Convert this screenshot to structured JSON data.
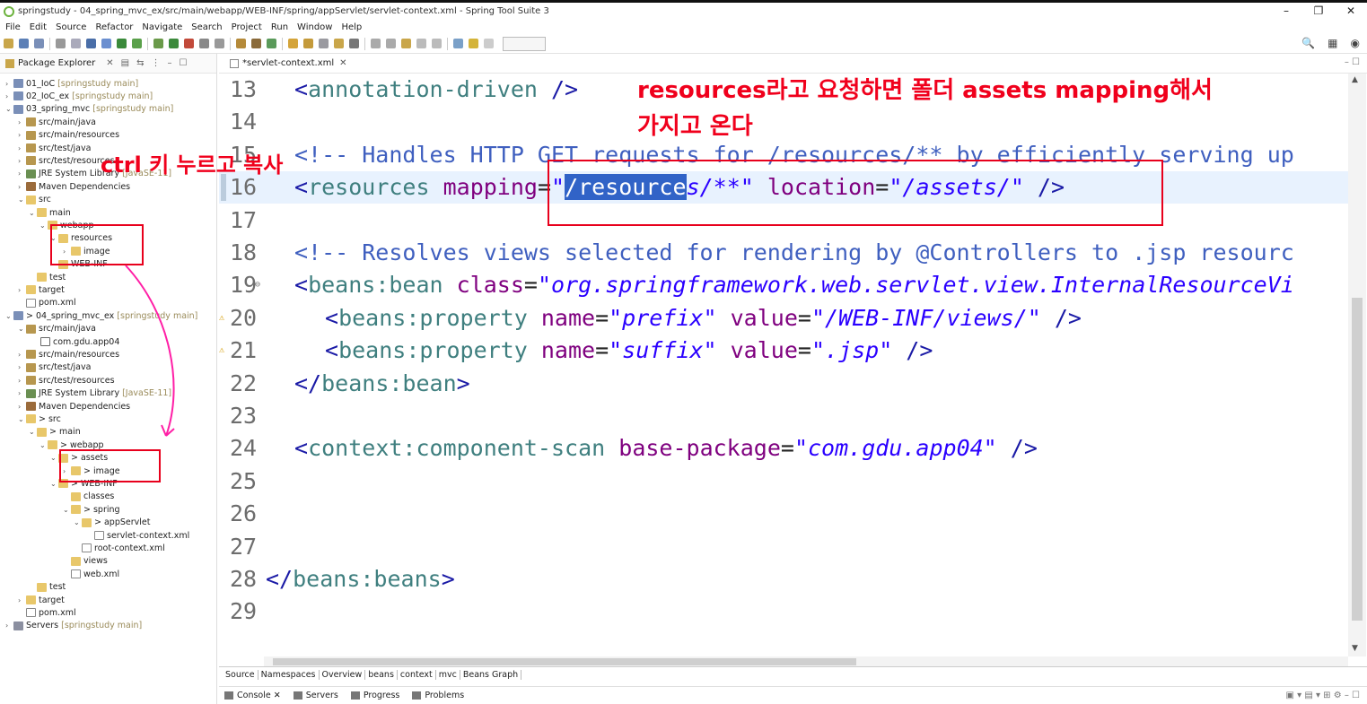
{
  "window": {
    "title": "springstudy - 04_spring_mvc_ex/src/main/webapp/WEB-INF/spring/appServlet/servlet-context.xml - Spring Tool Suite 3",
    "minimize": "–",
    "maximize": "❐",
    "close": "✕"
  },
  "menu": [
    "File",
    "Edit",
    "Source",
    "Refactor",
    "Navigate",
    "Search",
    "Project",
    "Run",
    "Window",
    "Help"
  ],
  "explorer": {
    "title": "Package Explorer",
    "rows": [
      {
        "label": "01_IoC",
        "suffix": "[springstudy main]"
      },
      {
        "label": "02_IoC_ex",
        "suffix": "[springstudy main]"
      },
      {
        "label": "03_spring_mvc",
        "suffix": "[springstudy main]"
      },
      {
        "label": "src/main/java",
        "suffix": ""
      },
      {
        "label": "src/main/resources",
        "suffix": ""
      },
      {
        "label": "src/test/java",
        "suffix": ""
      },
      {
        "label": "src/test/resources",
        "suffix": ""
      },
      {
        "label": "JRE System Library",
        "suffix": "[JavaSE-11]"
      },
      {
        "label": "Maven Dependencies",
        "suffix": ""
      },
      {
        "label": "src",
        "suffix": ""
      },
      {
        "label": "main",
        "suffix": ""
      },
      {
        "label": "webapp",
        "suffix": ""
      },
      {
        "label": "resources",
        "suffix": ""
      },
      {
        "label": "image",
        "suffix": ""
      },
      {
        "label": "WEB-INF",
        "suffix": ""
      },
      {
        "label": "test",
        "suffix": ""
      },
      {
        "label": "target",
        "suffix": ""
      },
      {
        "label": "pom.xml",
        "suffix": ""
      },
      {
        "label": "> 04_spring_mvc_ex",
        "suffix": "[springstudy main]"
      },
      {
        "label": "src/main/java",
        "suffix": ""
      },
      {
        "label": "com.gdu.app04",
        "suffix": ""
      },
      {
        "label": "src/main/resources",
        "suffix": ""
      },
      {
        "label": "src/test/java",
        "suffix": ""
      },
      {
        "label": "src/test/resources",
        "suffix": ""
      },
      {
        "label": "JRE System Library",
        "suffix": "[JavaSE-11]"
      },
      {
        "label": "Maven Dependencies",
        "suffix": ""
      },
      {
        "label": "> src",
        "suffix": ""
      },
      {
        "label": "> main",
        "suffix": ""
      },
      {
        "label": "> webapp",
        "suffix": ""
      },
      {
        "label": "> assets",
        "suffix": ""
      },
      {
        "label": "> image",
        "suffix": ""
      },
      {
        "label": "> WEB-INF",
        "suffix": ""
      },
      {
        "label": "classes",
        "suffix": ""
      },
      {
        "label": "> spring",
        "suffix": ""
      },
      {
        "label": "> appServlet",
        "suffix": ""
      },
      {
        "label": "servlet-context.xml",
        "suffix": ""
      },
      {
        "label": "root-context.xml",
        "suffix": ""
      },
      {
        "label": "views",
        "suffix": ""
      },
      {
        "label": "web.xml",
        "suffix": ""
      },
      {
        "label": "test",
        "suffix": ""
      },
      {
        "label": "target",
        "suffix": ""
      },
      {
        "label": "pom.xml",
        "suffix": ""
      },
      {
        "label": "Servers",
        "suffix": "[springstudy main]"
      }
    ]
  },
  "editor": {
    "tab": "*servlet-context.xml",
    "lines": [
      {
        "n": "13",
        "parts": [
          [
            "tag",
            "<"
          ],
          [
            "tagname",
            "annotation-driven"
          ],
          [
            "tag",
            " />"
          ]
        ]
      },
      {
        "n": "14",
        "parts": []
      },
      {
        "n": "15",
        "parts": [
          [
            "comment",
            "<!-- Handles HTTP GET requests for /resources/** by efficiently serving up"
          ]
        ]
      },
      {
        "n": "16",
        "parts": [
          [
            "tag",
            "<"
          ],
          [
            "tagname",
            "resources"
          ],
          [
            "plain",
            " "
          ],
          [
            "attr",
            "mapping"
          ],
          [
            "plain",
            "="
          ],
          [
            "val",
            "\""
          ],
          [
            "sel",
            "/resource"
          ],
          [
            "val",
            "s/**\""
          ],
          [
            "plain",
            " "
          ],
          [
            "attr",
            "location"
          ],
          [
            "plain",
            "="
          ],
          [
            "val",
            "\"/assets/\""
          ],
          [
            "tag",
            " />"
          ]
        ]
      },
      {
        "n": "17",
        "parts": []
      },
      {
        "n": "18",
        "parts": [
          [
            "comment",
            "<!-- Resolves views selected for rendering by @Controllers to .jsp resourc"
          ]
        ]
      },
      {
        "n": "19",
        "parts": [
          [
            "tag",
            "<"
          ],
          [
            "tagname",
            "beans:bean"
          ],
          [
            "plain",
            " "
          ],
          [
            "attr",
            "class"
          ],
          [
            "plain",
            "="
          ],
          [
            "val",
            "\"org.springframework.web.servlet.view.InternalResourceVi"
          ]
        ]
      },
      {
        "n": "20",
        "parts": [
          [
            "tag",
            "<"
          ],
          [
            "tagname",
            "beans:property"
          ],
          [
            "plain",
            " "
          ],
          [
            "attr",
            "name"
          ],
          [
            "plain",
            "="
          ],
          [
            "val",
            "\"prefix\""
          ],
          [
            "plain",
            " "
          ],
          [
            "attr",
            "value"
          ],
          [
            "plain",
            "="
          ],
          [
            "val",
            "\"/WEB-INF/views/\""
          ],
          [
            "tag",
            " />"
          ]
        ]
      },
      {
        "n": "21",
        "parts": [
          [
            "tag",
            "<"
          ],
          [
            "tagname",
            "beans:property"
          ],
          [
            "plain",
            " "
          ],
          [
            "attr",
            "name"
          ],
          [
            "plain",
            "="
          ],
          [
            "val",
            "\"suffix\""
          ],
          [
            "plain",
            " "
          ],
          [
            "attr",
            "value"
          ],
          [
            "plain",
            "="
          ],
          [
            "val",
            "\".jsp\""
          ],
          [
            "tag",
            " />"
          ]
        ]
      },
      {
        "n": "22",
        "parts": [
          [
            "tag",
            "</"
          ],
          [
            "tagname",
            "beans:bean"
          ],
          [
            "tag",
            ">"
          ]
        ]
      },
      {
        "n": "23",
        "parts": []
      },
      {
        "n": "24",
        "parts": [
          [
            "tag",
            "<"
          ],
          [
            "tagname",
            "context:component-scan"
          ],
          [
            "plain",
            " "
          ],
          [
            "attr",
            "base-package"
          ],
          [
            "plain",
            "="
          ],
          [
            "val",
            "\"com.gdu.app04\""
          ],
          [
            "tag",
            " />"
          ]
        ]
      },
      {
        "n": "25",
        "parts": []
      },
      {
        "n": "26",
        "parts": []
      },
      {
        "n": "27",
        "parts": []
      },
      {
        "n": "28",
        "parts": [
          [
            "tag",
            "</"
          ],
          [
            "tagname",
            "beans:beans"
          ],
          [
            "tag",
            ">"
          ]
        ]
      },
      {
        "n": "29",
        "parts": []
      }
    ]
  },
  "bottom_tabs": [
    "Source",
    "Namespaces",
    "Overview",
    "beans",
    "context",
    "mvc",
    "Beans Graph"
  ],
  "console_tabs": [
    "Console",
    "Servers",
    "Progress",
    "Problems"
  ],
  "annotations": {
    "top_line1": "resources라고 요청하면 폴더 assets mapping해서",
    "top_line2": "가지고 온다",
    "ctrl": "ctrl 키 누르고 복사"
  },
  "colors": {
    "annotation": "#e8001c",
    "selection": "#3163c7",
    "arrow": "#ff1fa6"
  }
}
